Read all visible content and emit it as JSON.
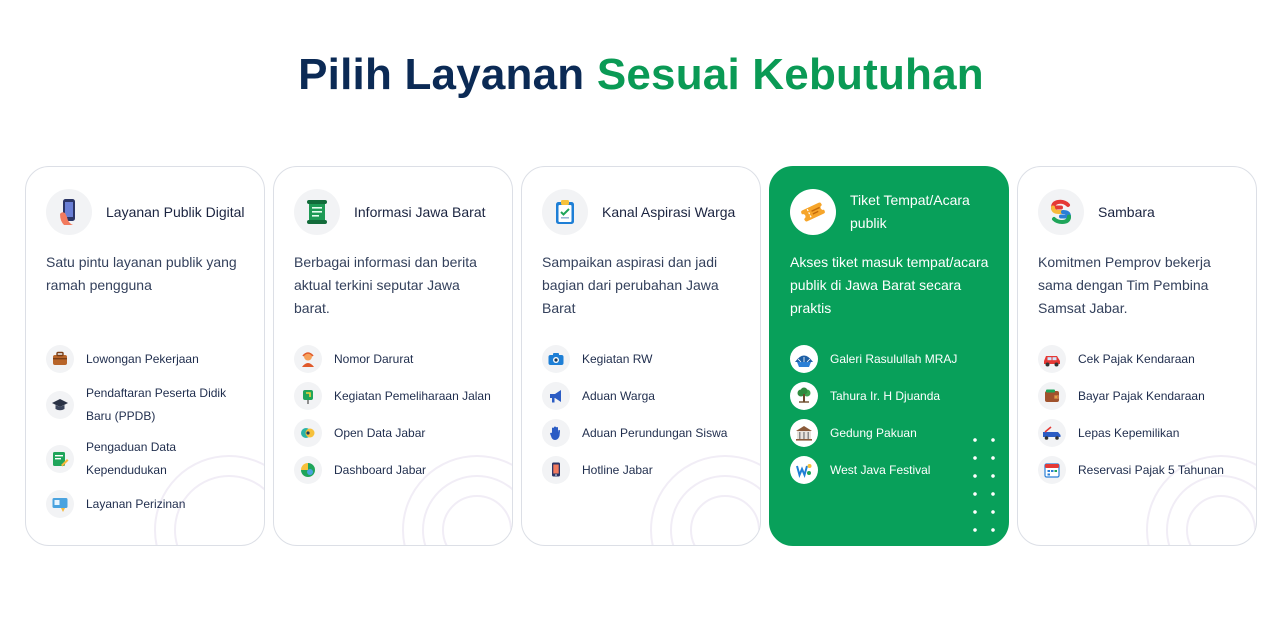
{
  "heading": {
    "part1": "Pilih Layanan",
    "part2": "Sesuai Kebutuhan"
  },
  "colors": {
    "navy": "#0b2a55",
    "green": "#0a9a55",
    "card_green": "#08a05a"
  },
  "cards": [
    {
      "title": "Layanan Publik Digital",
      "icon": "phone-hand-icon",
      "description": "Satu pintu layanan publik yang ramah pengguna",
      "items": [
        {
          "label": "Lowongan Pekerjaan",
          "icon": "briefcase-icon"
        },
        {
          "label": "Pendaftaran Peserta Didik Baru (PPDB)",
          "icon": "graduation-cap-icon"
        },
        {
          "label": "Pengaduan Data Kependudukan",
          "icon": "edit-document-icon"
        },
        {
          "label": "Layanan Perizinan",
          "icon": "license-icon"
        }
      ]
    },
    {
      "title": "Informasi Jawa Barat",
      "icon": "scroll-icon",
      "description": "Berbagai informasi dan berita aktual terkini seputar Jawa barat.",
      "items": [
        {
          "label": "Nomor Darurat",
          "icon": "operator-icon"
        },
        {
          "label": "Kegiatan Pemeliharaan Jalan",
          "icon": "road-sign-icon"
        },
        {
          "label": "Open Data Jabar",
          "icon": "open-data-icon"
        },
        {
          "label": "Dashboard Jabar",
          "icon": "dashboard-icon"
        }
      ]
    },
    {
      "title": "Kanal Aspirasi Warga",
      "icon": "clipboard-icon",
      "description": "Sampaikan aspirasi dan jadi bagian dari perubahan Jawa Barat",
      "items": [
        {
          "label": "Kegiatan RW",
          "icon": "camera-icon"
        },
        {
          "label": "Aduan Warga",
          "icon": "megaphone-icon"
        },
        {
          "label": "Aduan Perundungan Siswa",
          "icon": "hand-stop-icon"
        },
        {
          "label": "Hotline Jabar",
          "icon": "phone-icon"
        }
      ]
    },
    {
      "title": "Tiket Tempat/Acara publik",
      "icon": "ticket-icon",
      "description": "Akses tiket masuk tempat/acara publik di Jawa Barat secara praktis",
      "items": [
        {
          "label": "Galeri Rasulullah MRAJ",
          "icon": "dome-icon"
        },
        {
          "label": "Tahura Ir. H Djuanda",
          "icon": "tree-icon"
        },
        {
          "label": "Gedung Pakuan",
          "icon": "building-icon"
        },
        {
          "label": "West Java Festival",
          "icon": "festival-logo-icon"
        }
      ]
    },
    {
      "title": "Sambara",
      "icon": "sambara-logo-icon",
      "description": "Komitmen Pemprov bekerja sama dengan Tim Pembina Samsat Jabar.",
      "items": [
        {
          "label": "Cek Pajak Kendaraan",
          "icon": "car-icon"
        },
        {
          "label": "Bayar Pajak Kendaraan",
          "icon": "wallet-icon"
        },
        {
          "label": "Lepas Kepemilikan",
          "icon": "tow-truck-icon"
        },
        {
          "label": "Reservasi Pajak 5 Tahunan",
          "icon": "calendar-icon"
        }
      ]
    }
  ]
}
